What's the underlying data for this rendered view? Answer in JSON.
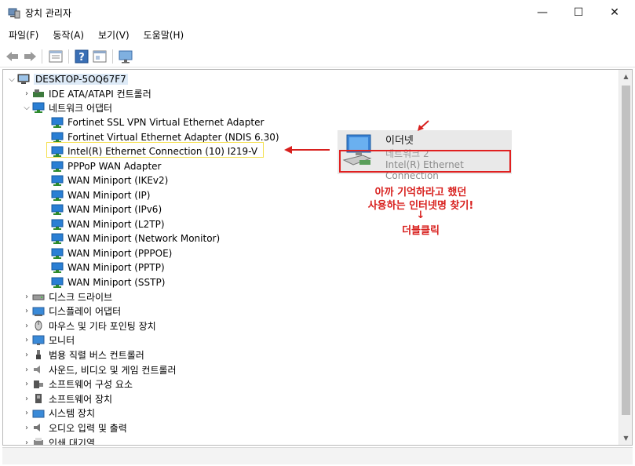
{
  "window": {
    "title": "장치 관리자",
    "minimize": "—",
    "maximize": "☐",
    "close": "✕"
  },
  "menu": [
    "파일(F)",
    "동작(A)",
    "보기(V)",
    "도움말(H)"
  ],
  "toolbar": [
    "back-icon",
    "forward-icon",
    "properties-icon",
    "help-icon",
    "show-hidden-icon",
    "computer-monitor-icon"
  ],
  "tree": {
    "root": "DESKTOP-5OQ67F7",
    "categories": [
      {
        "label": "IDE ATA/ATAPI 컨트롤러",
        "expanded": false,
        "icon": "ide-controller-icon"
      },
      {
        "label": "네트워크 어댑터",
        "expanded": true,
        "icon": "network-adapter-icon",
        "children": [
          "Fortinet SSL VPN Virtual Ethernet Adapter",
          "Fortinet Virtual Ethernet Adapter (NDIS 6.30)",
          "Intel(R) Ethernet Connection (10) I219-V",
          "PPPoP WAN Adapter",
          "WAN Miniport (IKEv2)",
          "WAN Miniport (IP)",
          "WAN Miniport (IPv6)",
          "WAN Miniport (L2TP)",
          "WAN Miniport (Network Monitor)",
          "WAN Miniport (PPPOE)",
          "WAN Miniport (PPTP)",
          "WAN Miniport (SSTP)"
        ]
      },
      {
        "label": "디스크 드라이브",
        "expanded": false,
        "icon": "disk-drive-icon"
      },
      {
        "label": "디스플레이 어댑터",
        "expanded": false,
        "icon": "display-adapter-icon"
      },
      {
        "label": "마우스 및 기타 포인팅 장치",
        "expanded": false,
        "icon": "mouse-icon"
      },
      {
        "label": "모니터",
        "expanded": false,
        "icon": "monitor-icon"
      },
      {
        "label": "범용 직렬 버스 컨트롤러",
        "expanded": false,
        "icon": "usb-icon"
      },
      {
        "label": "사운드, 비디오 및 게임 컨트롤러",
        "expanded": false,
        "icon": "sound-icon"
      },
      {
        "label": "소프트웨어 구성 요소",
        "expanded": false,
        "icon": "software-component-icon"
      },
      {
        "label": "소프트웨어 장치",
        "expanded": false,
        "icon": "software-device-icon"
      },
      {
        "label": "시스템 장치",
        "expanded": false,
        "icon": "system-device-icon"
      },
      {
        "label": "오디오 입력 및 출력",
        "expanded": false,
        "icon": "audio-io-icon"
      },
      {
        "label": "인쇄 대기열",
        "expanded": false,
        "icon": "print-queue-icon"
      }
    ]
  },
  "popup": {
    "title": "이더넷",
    "network": "네트워크 2",
    "adapter": "Intel(R) Ethernet Connection"
  },
  "annotation": {
    "line1": "아까 기억하라고 했던",
    "line2": "사용하는 인터넷명 찾기!",
    "arrow": "↓",
    "line3": "더블클릭",
    "left_arrow": "←",
    "diag_arrow": "↙"
  },
  "colors": {
    "accent_red": "#d8201e",
    "highlight_yellow": "#f4e04d",
    "adapter_blue": "#2a7fd4"
  }
}
